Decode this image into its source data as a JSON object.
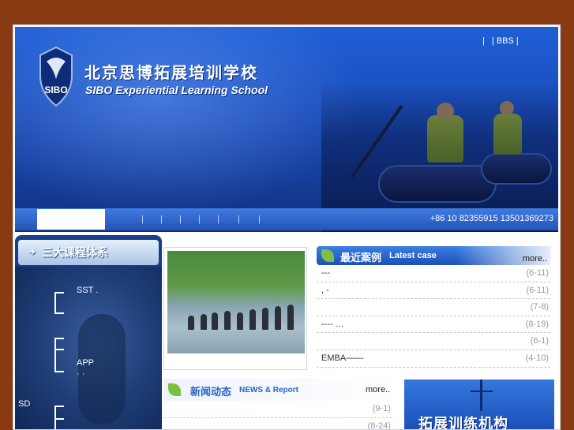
{
  "header": {
    "title_cn": "北京思博拓展培训学校",
    "title_en": "SIBO Experiential Learning School",
    "logo_text": "SIBO",
    "top_links": [
      "|",
      "| BBS |"
    ]
  },
  "nav": {
    "separators": [
      "|",
      "|",
      "|",
      "|",
      "|",
      "|",
      "|"
    ],
    "phone": "+86 10 82355915 13501369273"
  },
  "left": {
    "title": "三大课程体系",
    "arrow": "➜",
    "items": [
      {
        "label": "SST   ."
      },
      {
        "label": "APP"
      },
      {
        "label": "·  ·"
      },
      {
        "label": "SD"
      }
    ]
  },
  "latest_case": {
    "title_cn": "最近案例",
    "title_en": "Latest case",
    "more": "more..",
    "rows": [
      {
        "title": "---",
        "date": "(6-11)"
      },
      {
        "title": ",       -",
        "date": "(6-11)"
      },
      {
        "title": "",
        "date": "(7-8)"
      },
      {
        "title": "----                …",
        "date": "(8-19)"
      },
      {
        "title": "",
        "date": "(6-1)"
      },
      {
        "title": "EMBA——",
        "date": "(4-10)"
      }
    ]
  },
  "news": {
    "title_cn": "新闻动态",
    "title_en": "NEWS & Report",
    "more": "more..",
    "rows": [
      {
        "title": "",
        "date": "(9-1)"
      },
      {
        "title": "",
        "date": "(8-24)"
      }
    ]
  },
  "ad": {
    "text": "拓展训练机构"
  },
  "colors": {
    "background": "#8a3a12",
    "banner_blue": "#1b4fbe",
    "accent_green": "#7bc043"
  }
}
